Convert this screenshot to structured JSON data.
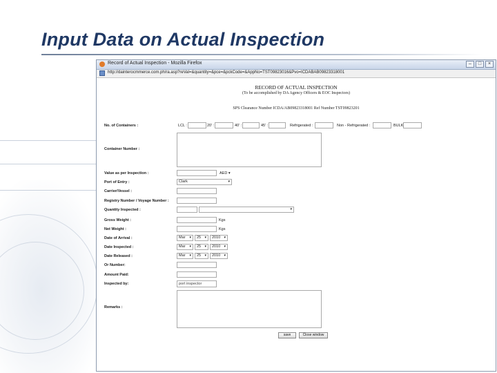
{
  "slide": {
    "title": "Input Data on Actual Inspection"
  },
  "window": {
    "title": "Record of Actual Inspection - Mozilla Firefox",
    "url": "http://dainterocmmerce.com.ph/ra.asp?reVal=&quantity=&pce=&pckCode=&AppNo=TST09823016&Pvo=ICDABAB09823318001"
  },
  "form": {
    "heading": "RECORD OF ACTUAL INSPECTION",
    "subheading": "(To be accomplished by DA Agency Officers & EOC Inspectors)",
    "clearance_line": "SPS Clearance Number ICDA/AB09823318001   Ref Number TST09823201",
    "containers": {
      "label": "No. of Containers :",
      "lcl": "LCL :",
      "c20": "20' :",
      "c40": "40' :",
      "c45": "45' :",
      "refrigerated": "Refrigerated :",
      "non_refrigerated": "Non - Refrigerated :",
      "bulk": "BULK :"
    },
    "labels": {
      "container_number": "Container Number :",
      "value_inspection": "Value as per Inspection :",
      "port_of_entry": "Port of Entry :",
      "carrier_vessel": "Carrier/Vessel :",
      "registry_voyage": "Registry Number / Voyage Number :",
      "quantity_inspected": "Quantity Inspected :",
      "gross_weight": "Gross Weight :",
      "net_weight": "Net Weight :",
      "date_arrival": "Date of Arrival :",
      "date_inspected": "Date Inspected :",
      "date_released": "Date Released :",
      "or_number": "Or Number:",
      "amount_paid": "Amount Paid:",
      "inspected_by": "Inspected by:",
      "remarks": "Remarks :"
    },
    "currency": "AED",
    "port_value": "Clark",
    "unit_kgs": "Kgs",
    "date_arrival": {
      "month": "Mar",
      "day": "25",
      "year": "2010"
    },
    "date_inspected": {
      "month": "Mar",
      "day": "25",
      "year": "2010"
    },
    "date_released": {
      "month": "Mar",
      "day": "25",
      "year": "2010"
    },
    "inspector_value": "port inspector",
    "save_label": "save",
    "close_label": "Close window"
  }
}
